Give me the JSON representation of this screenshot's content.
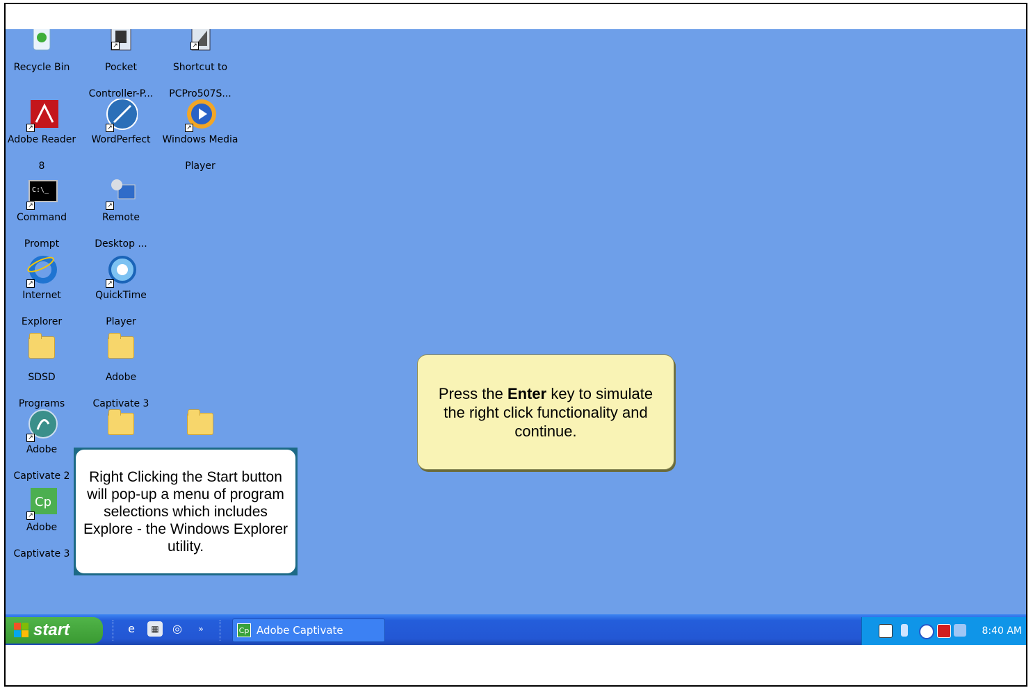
{
  "desktop": {
    "icons": [
      {
        "name": "recycle-bin",
        "line1": "Recycle Bin",
        "line2": ""
      },
      {
        "name": "pocket-controller",
        "line1": "Pocket",
        "line2": "Controller-P..."
      },
      {
        "name": "shortcut-pcpro",
        "line1": "Shortcut to",
        "line2": "PCPro507S..."
      },
      {
        "name": "adobe-reader",
        "line1": "Adobe Reader",
        "line2": "8"
      },
      {
        "name": "wordperfect",
        "line1": "WordPerfect",
        "line2": ""
      },
      {
        "name": "windows-media-player",
        "line1": "Windows Media",
        "line2": "Player"
      },
      {
        "name": "command-prompt",
        "line1": "Command",
        "line2": "Prompt"
      },
      {
        "name": "remote-desktop",
        "line1": "Remote",
        "line2": "Desktop ..."
      },
      {
        "name": "internet-explorer",
        "line1": "Internet",
        "line2": "Explorer"
      },
      {
        "name": "quicktime-player",
        "line1": "QuickTime",
        "line2": "Player"
      },
      {
        "name": "sdsd-programs",
        "line1": "SDSD",
        "line2": "Programs"
      },
      {
        "name": "adobe-captivate-3-folder",
        "line1": "Adobe",
        "line2": "Captivate 3"
      },
      {
        "name": "adobe-captivate-2",
        "line1": "Adobe",
        "line2": "Captivate 2"
      },
      {
        "name": "adobe-captivate-3",
        "line1": "Adobe",
        "line2": "Captivate 3"
      }
    ]
  },
  "callouts": {
    "yellow": {
      "before": "Press the ",
      "bold": "Enter",
      "after": " key to simulate the right click functionality and continue."
    },
    "white": {
      "text": "Right Clicking the Start button will pop-up a menu of program selections which includes Explore - the Windows Explorer utility."
    }
  },
  "taskbar": {
    "start_label": "start",
    "task_label": "Adobe Captivate",
    "task_icon_text": "Cp",
    "clock": "8:40 AM"
  },
  "icons": {
    "cmd_text": "C:\\_",
    "cp_text": "Cp"
  }
}
